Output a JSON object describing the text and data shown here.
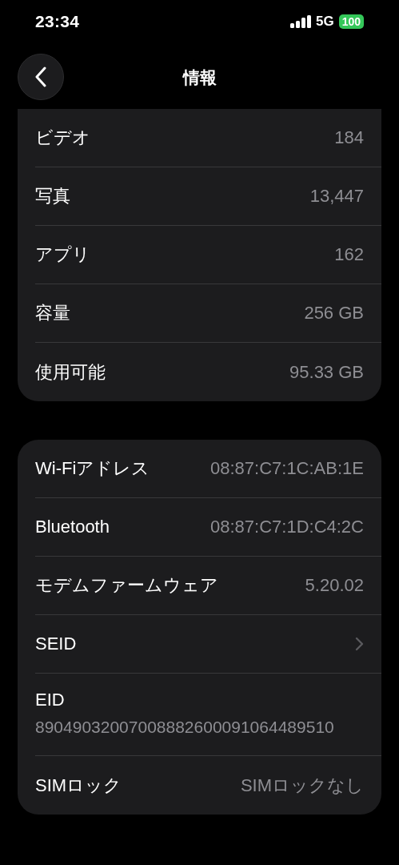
{
  "status_bar": {
    "time": "23:34",
    "network": "5G",
    "battery": "100"
  },
  "nav": {
    "title": "情報"
  },
  "groups": [
    {
      "rows": [
        {
          "kind": "value",
          "label": "ビデオ",
          "value": "184"
        },
        {
          "kind": "value",
          "label": "写真",
          "value": "13,447"
        },
        {
          "kind": "value",
          "label": "アプリ",
          "value": "162"
        },
        {
          "kind": "value",
          "label": "容量",
          "value": "256 GB"
        },
        {
          "kind": "value",
          "label": "使用可能",
          "value": "95.33 GB"
        }
      ]
    },
    {
      "rows": [
        {
          "kind": "value",
          "label": "Wi-Fiアドレス",
          "value": "08:87:C7:1C:AB:1E"
        },
        {
          "kind": "value",
          "label": "Bluetooth",
          "value": "08:87:C7:1D:C4:2C"
        },
        {
          "kind": "value",
          "label": "モデムファームウェア",
          "value": "5.20.02"
        },
        {
          "kind": "link",
          "label": "SEID"
        },
        {
          "kind": "stacked",
          "label": "EID",
          "value": "89049032007008882600091064489510"
        },
        {
          "kind": "value",
          "label": "SIMロック",
          "value": "SIMロックなし"
        }
      ]
    }
  ]
}
